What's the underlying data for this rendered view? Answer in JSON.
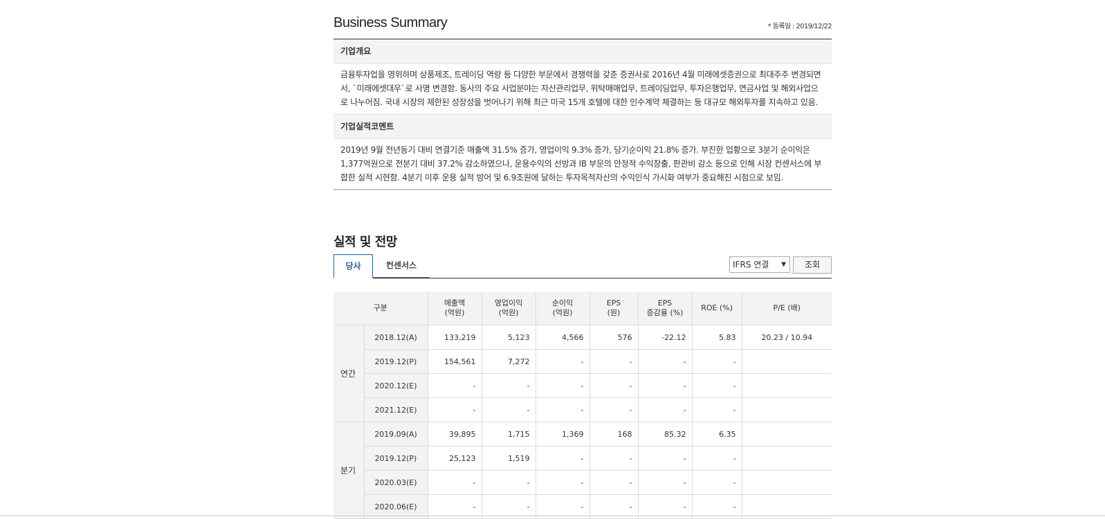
{
  "business_summary": {
    "title": "Business Summary",
    "reg_date": "* 등록일 : 2019/12/22",
    "overview_heading": "기업개요",
    "overview_text": "금융투자업을 영위하며 상품제조, 트레이딩 역량 등 다양한 부문에서 경쟁력을 갖춘 증권사로 2016년 4월 미래에셋증권으로 최대주주 변경되면서, `미래에셋대우`로 사명 변경함. 동사의 주요 사업분야는 자산관리업무, 위탁매매업무, 트레이딩업무, 투자은행업무, 연금사업 및 해외사업으로 나누어짐. 국내 시장의 제한된 성장성을 벗어나기 위해 최근 미국 15개 호텔에 대한 인수계약 체결하는 등 대규모 해외투자를 지속하고 있음.",
    "comment_heading": "기업실적코멘트",
    "comment_text": "2019년 9월 전년동기 대비 연결기준 매출액 31.5% 증가, 영업이익 9.3% 증가, 당기순이익 21.8% 증가. 부진한 업황으로 3분기 순이익은 1,377억원으로 전분기 대비 37.2% 감소하였으나, 운용수익의 선방과 IB 부문의 안정적 수익창출, 판관비 감소 등으로 인해 시장 컨센서스에 부합한 실적 시현함. 4분기 이후 운용 실적 방어 및 6.9조원에 달하는 투자목적자산의 수익인식 가시화 여부가 중요해진 시점으로 보임."
  },
  "performance": {
    "title": "실적 및 전망",
    "tabs": [
      "당사",
      "컨센서스"
    ],
    "select_value": "IFRS 연결",
    "search_button": "조회",
    "headers": {
      "c0": "구분",
      "c1a": "매출액",
      "c1b": "(억원)",
      "c2a": "영업이익",
      "c2b": "(억원)",
      "c3a": "순이익",
      "c3b": "(억원)",
      "c4a": "EPS",
      "c4b": "(원)",
      "c5a": "EPS",
      "c5b": "증감율 (%)",
      "c6": "ROE (%)",
      "c7": "P/E (배)"
    },
    "groups": {
      "annual": "연간",
      "quarterly": "분기"
    },
    "rows": [
      [
        "2018.12(A)",
        "133,219",
        "5,123",
        "4,566",
        "576",
        "-22.12",
        "5.83",
        "20.23 / 10.94"
      ],
      [
        "2019.12(P)",
        "154,561",
        "7,272",
        "-",
        "-",
        "-",
        "-",
        ""
      ],
      [
        "2020.12(E)",
        "-",
        "-",
        "-",
        "-",
        "-",
        "-",
        ""
      ],
      [
        "2021.12(E)",
        "-",
        "-",
        "-",
        "-",
        "-",
        "-",
        ""
      ],
      [
        "2019.09(A)",
        "39,895",
        "1,715",
        "1,369",
        "168",
        "85.32",
        "6.35",
        ""
      ],
      [
        "2019.12(P)",
        "25,123",
        "1,519",
        "-",
        "-",
        "-",
        "-",
        ""
      ],
      [
        "2020.03(E)",
        "-",
        "-",
        "-",
        "-",
        "-",
        "-",
        ""
      ],
      [
        "2020.06(E)",
        "-",
        "-",
        "-",
        "-",
        "-",
        "-",
        ""
      ]
    ]
  }
}
